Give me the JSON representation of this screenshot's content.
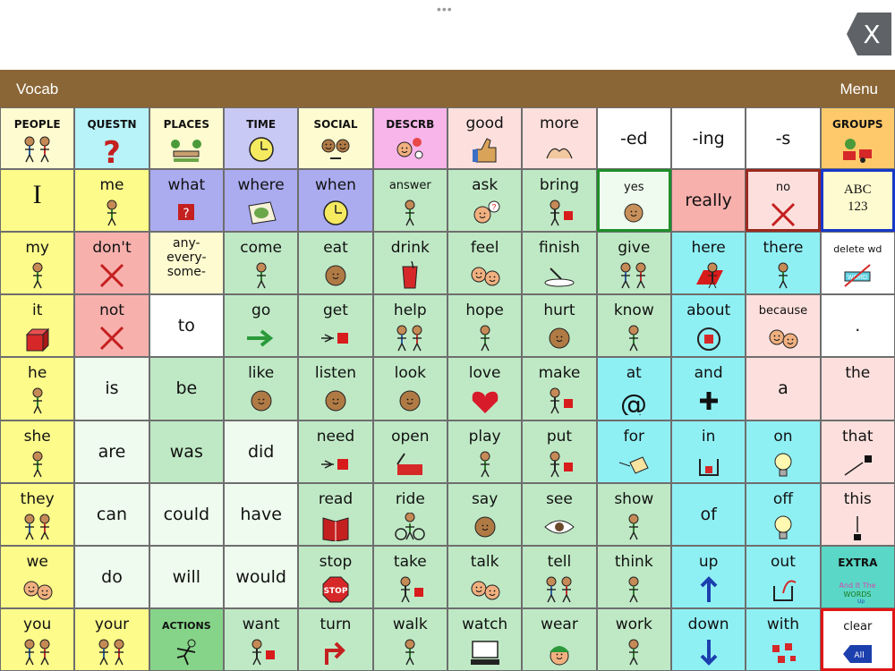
{
  "menu_bar": {
    "left": "Vocab",
    "right": "Menu"
  },
  "grid": [
    [
      {
        "label": "PEOPLE",
        "color": "c-lyellow",
        "style": "tag",
        "icon": "people-icon"
      },
      {
        "label": "QUESTN",
        "color": "c-cyan",
        "style": "tag",
        "icon": "question-icon"
      },
      {
        "label": "PLACES",
        "color": "c-lyellow",
        "style": "tag",
        "icon": "places-icon"
      },
      {
        "label": "TIME",
        "color": "c-lav",
        "style": "tag",
        "icon": "clock-icon"
      },
      {
        "label": "SOCIAL",
        "color": "c-lyellow",
        "style": "tag",
        "icon": "social-icon"
      },
      {
        "label": "DESCRB",
        "color": "c-pink",
        "style": "tag",
        "icon": "describe-icon"
      },
      {
        "label": "good",
        "color": "c-rose",
        "style": "",
        "icon": "thumbs-up-icon"
      },
      {
        "label": "more",
        "color": "c-rose",
        "style": "",
        "icon": "more-hands-icon"
      },
      {
        "label": "-ed",
        "color": "c-white",
        "style": "mid",
        "icon": ""
      },
      {
        "label": "-ing",
        "color": "c-white",
        "style": "mid",
        "icon": ""
      },
      {
        "label": "-s",
        "color": "c-white",
        "style": "mid",
        "icon": ""
      },
      {
        "label": "GROUPS",
        "color": "c-orange",
        "style": "tag",
        "icon": "groups-icon"
      }
    ],
    [
      {
        "label": "I",
        "color": "c-yellow",
        "style": "mid",
        "icon": ""
      },
      {
        "label": "me",
        "color": "c-yellow",
        "style": "",
        "icon": "person-icon"
      },
      {
        "label": "what",
        "color": "c-purple",
        "style": "",
        "icon": "question-box-icon"
      },
      {
        "label": "where",
        "color": "c-purple",
        "style": "",
        "icon": "map-icon"
      },
      {
        "label": "when",
        "color": "c-purple",
        "style": "",
        "icon": "clock-icon"
      },
      {
        "label": "answer",
        "color": "c-green",
        "style": "small",
        "icon": "person-icon"
      },
      {
        "label": "ask",
        "color": "c-green",
        "style": "",
        "icon": "face-question-icon"
      },
      {
        "label": "bring",
        "color": "c-green",
        "style": "",
        "icon": "person-box-icon"
      },
      {
        "label": "yes",
        "color": "c-mint",
        "style": "small",
        "icon": "smile-face-icon",
        "border": "b-green"
      },
      {
        "label": "really",
        "color": "c-red",
        "style": "mid",
        "icon": ""
      },
      {
        "label": "no",
        "color": "c-rose",
        "style": "small",
        "icon": "x-mark-icon",
        "border": "b-brown"
      },
      {
        "label": "ABC 123",
        "color": "c-lyellow",
        "style": "multi-serif",
        "icon": "",
        "border": "b-blue"
      }
    ],
    [
      {
        "label": "my",
        "color": "c-yellow",
        "style": "",
        "icon": "person-icon"
      },
      {
        "label": "don't",
        "color": "c-red",
        "style": "",
        "icon": "x-mark-icon"
      },
      {
        "label": "any-\nevery-\nsome-",
        "color": "c-lyellow",
        "style": "multi",
        "icon": ""
      },
      {
        "label": "come",
        "color": "c-green",
        "style": "",
        "icon": "person-icon"
      },
      {
        "label": "eat",
        "color": "c-green",
        "style": "",
        "icon": "face-icon"
      },
      {
        "label": "drink",
        "color": "c-green",
        "style": "",
        "icon": "cup-icon"
      },
      {
        "label": "feel",
        "color": "c-green",
        "style": "",
        "icon": "faces-icon"
      },
      {
        "label": "finish",
        "color": "c-green",
        "style": "",
        "icon": "hand-plate-icon"
      },
      {
        "label": "give",
        "color": "c-green",
        "style": "",
        "icon": "people-icon"
      },
      {
        "label": "here",
        "color": "c-aqua",
        "style": "",
        "icon": "here-mat-icon"
      },
      {
        "label": "there",
        "color": "c-aqua",
        "style": "",
        "icon": "person-icon"
      },
      {
        "label": "delete wd",
        "color": "c-white",
        "style": "tiny",
        "icon": "delete-word-icon"
      }
    ],
    [
      {
        "label": "it",
        "color": "c-yellow",
        "style": "",
        "icon": "red-cube-icon"
      },
      {
        "label": "not",
        "color": "c-red",
        "style": "",
        "icon": "x-mark-icon"
      },
      {
        "label": "to",
        "color": "c-white",
        "style": "mid",
        "icon": ""
      },
      {
        "label": "go",
        "color": "c-green",
        "style": "",
        "icon": "green-arrow-icon"
      },
      {
        "label": "get",
        "color": "c-green",
        "style": "",
        "icon": "hand-box-icon"
      },
      {
        "label": "help",
        "color": "c-green",
        "style": "",
        "icon": "people-icon"
      },
      {
        "label": "hope",
        "color": "c-green",
        "style": "",
        "icon": "person-icon"
      },
      {
        "label": "hurt",
        "color": "c-green",
        "style": "",
        "icon": "face-icon"
      },
      {
        "label": "know",
        "color": "c-green",
        "style": "",
        "icon": "person-icon"
      },
      {
        "label": "about",
        "color": "c-aqua",
        "style": "",
        "icon": "circle-arrow-icon"
      },
      {
        "label": "because",
        "color": "c-rose",
        "style": "small",
        "icon": "faces-icon"
      },
      {
        "label": ".",
        "color": "c-white",
        "style": "mid",
        "icon": ""
      }
    ],
    [
      {
        "label": "he",
        "color": "c-yellow",
        "style": "",
        "icon": "person-icon"
      },
      {
        "label": "is",
        "color": "c-mint",
        "style": "mid",
        "icon": ""
      },
      {
        "label": "be",
        "color": "c-green",
        "style": "mid",
        "icon": ""
      },
      {
        "label": "like",
        "color": "c-green",
        "style": "",
        "icon": "face-icon"
      },
      {
        "label": "listen",
        "color": "c-green",
        "style": "",
        "icon": "face-icon"
      },
      {
        "label": "look",
        "color": "c-green",
        "style": "",
        "icon": "face-icon"
      },
      {
        "label": "love",
        "color": "c-green",
        "style": "",
        "icon": "heart-icon"
      },
      {
        "label": "make",
        "color": "c-green",
        "style": "",
        "icon": "person-box-icon"
      },
      {
        "label": "at",
        "color": "c-aqua",
        "style": "",
        "icon": "at-sign-icon"
      },
      {
        "label": "and",
        "color": "c-aqua",
        "style": "",
        "icon": "plus-icon"
      },
      {
        "label": "a",
        "color": "c-rose",
        "style": "mid",
        "icon": ""
      },
      {
        "label": "the",
        "color": "c-rose",
        "style": "",
        "icon": ""
      }
    ],
    [
      {
        "label": "she",
        "color": "c-yellow",
        "style": "",
        "icon": "person-icon"
      },
      {
        "label": "are",
        "color": "c-mint",
        "style": "mid",
        "icon": ""
      },
      {
        "label": "was",
        "color": "c-green",
        "style": "mid",
        "icon": ""
      },
      {
        "label": "did",
        "color": "c-mint",
        "style": "mid",
        "icon": ""
      },
      {
        "label": "need",
        "color": "c-green",
        "style": "",
        "icon": "hand-box-icon"
      },
      {
        "label": "open",
        "color": "c-green",
        "style": "",
        "icon": "open-box-icon"
      },
      {
        "label": "play",
        "color": "c-green",
        "style": "",
        "icon": "person-icon"
      },
      {
        "label": "put",
        "color": "c-green",
        "style": "",
        "icon": "person-box-icon"
      },
      {
        "label": "for",
        "color": "c-aqua",
        "style": "",
        "icon": "tag-icon"
      },
      {
        "label": "in",
        "color": "c-aqua",
        "style": "",
        "icon": "in-box-icon"
      },
      {
        "label": "on",
        "color": "c-aqua",
        "style": "",
        "icon": "lightbulb-icon"
      },
      {
        "label": "that",
        "color": "c-rose",
        "style": "",
        "icon": "point-icon"
      }
    ],
    [
      {
        "label": "they",
        "color": "c-yellow",
        "style": "",
        "icon": "people-icon"
      },
      {
        "label": "can",
        "color": "c-mint",
        "style": "mid",
        "icon": ""
      },
      {
        "label": "could",
        "color": "c-mint",
        "style": "mid",
        "icon": ""
      },
      {
        "label": "have",
        "color": "c-mint",
        "style": "mid",
        "icon": ""
      },
      {
        "label": "read",
        "color": "c-green",
        "style": "",
        "icon": "book-icon"
      },
      {
        "label": "ride",
        "color": "c-green",
        "style": "",
        "icon": "bike-icon"
      },
      {
        "label": "say",
        "color": "c-green",
        "style": "",
        "icon": "face-icon"
      },
      {
        "label": "see",
        "color": "c-green",
        "style": "",
        "icon": "eye-icon"
      },
      {
        "label": "show",
        "color": "c-green",
        "style": "",
        "icon": "person-icon"
      },
      {
        "label": "of",
        "color": "c-aqua",
        "style": "mid",
        "icon": ""
      },
      {
        "label": "off",
        "color": "c-aqua",
        "style": "",
        "icon": "lightbulb-icon"
      },
      {
        "label": "this",
        "color": "c-rose",
        "style": "",
        "icon": "point-down-icon"
      }
    ],
    [
      {
        "label": "we",
        "color": "c-yellow",
        "style": "",
        "icon": "faces-icon"
      },
      {
        "label": "do",
        "color": "c-mint",
        "style": "mid",
        "icon": ""
      },
      {
        "label": "will",
        "color": "c-mint",
        "style": "mid",
        "icon": ""
      },
      {
        "label": "would",
        "color": "c-mint",
        "style": "mid",
        "icon": ""
      },
      {
        "label": "stop",
        "color": "c-green",
        "style": "",
        "icon": "stop-sign-icon"
      },
      {
        "label": "take",
        "color": "c-green",
        "style": "",
        "icon": "person-box-icon"
      },
      {
        "label": "talk",
        "color": "c-green",
        "style": "",
        "icon": "faces-icon"
      },
      {
        "label": "tell",
        "color": "c-green",
        "style": "",
        "icon": "people-icon"
      },
      {
        "label": "think",
        "color": "c-green",
        "style": "",
        "icon": "person-icon"
      },
      {
        "label": "up",
        "color": "c-aqua",
        "style": "",
        "icon": "up-arrow-icon"
      },
      {
        "label": "out",
        "color": "c-aqua",
        "style": "",
        "icon": "out-arrow-icon"
      },
      {
        "label": "EXTRA",
        "color": "c-teal",
        "style": "tag",
        "icon": "extra-words-icon"
      }
    ],
    [
      {
        "label": "you",
        "color": "c-yellow",
        "style": "",
        "icon": "people-icon"
      },
      {
        "label": "your",
        "color": "c-yellow",
        "style": "",
        "icon": "people-icon"
      },
      {
        "label": "ACTIONS",
        "color": "c-dgreen",
        "style": "tiny-tag",
        "icon": "running-icon"
      },
      {
        "label": "want",
        "color": "c-green",
        "style": "",
        "icon": "person-box-icon"
      },
      {
        "label": "turn",
        "color": "c-green",
        "style": "",
        "icon": "turn-arrow-icon"
      },
      {
        "label": "walk",
        "color": "c-green",
        "style": "",
        "icon": "person-icon"
      },
      {
        "label": "watch",
        "color": "c-green",
        "style": "",
        "icon": "tv-icon"
      },
      {
        "label": "wear",
        "color": "c-green",
        "style": "",
        "icon": "cap-icon"
      },
      {
        "label": "work",
        "color": "c-green",
        "style": "",
        "icon": "person-icon"
      },
      {
        "label": "down",
        "color": "c-aqua",
        "style": "",
        "icon": "down-arrow-icon"
      },
      {
        "label": "with",
        "color": "c-aqua",
        "style": "",
        "icon": "blocks-icon"
      },
      {
        "label": "clear",
        "color": "c-white",
        "style": "small",
        "icon": "clear-all-icon",
        "border": "b-red"
      }
    ]
  ],
  "icons": {
    "clear_message_button": "x-backspace-icon",
    "drag_handle": "ellipsis-icon"
  },
  "colors": {
    "menu_bar": "#8a6636",
    "verbs": "#bfe9c5",
    "pronouns": "#fdfb8a",
    "prepositions": "#8ff0f4",
    "negation": "#f8b0ad"
  }
}
